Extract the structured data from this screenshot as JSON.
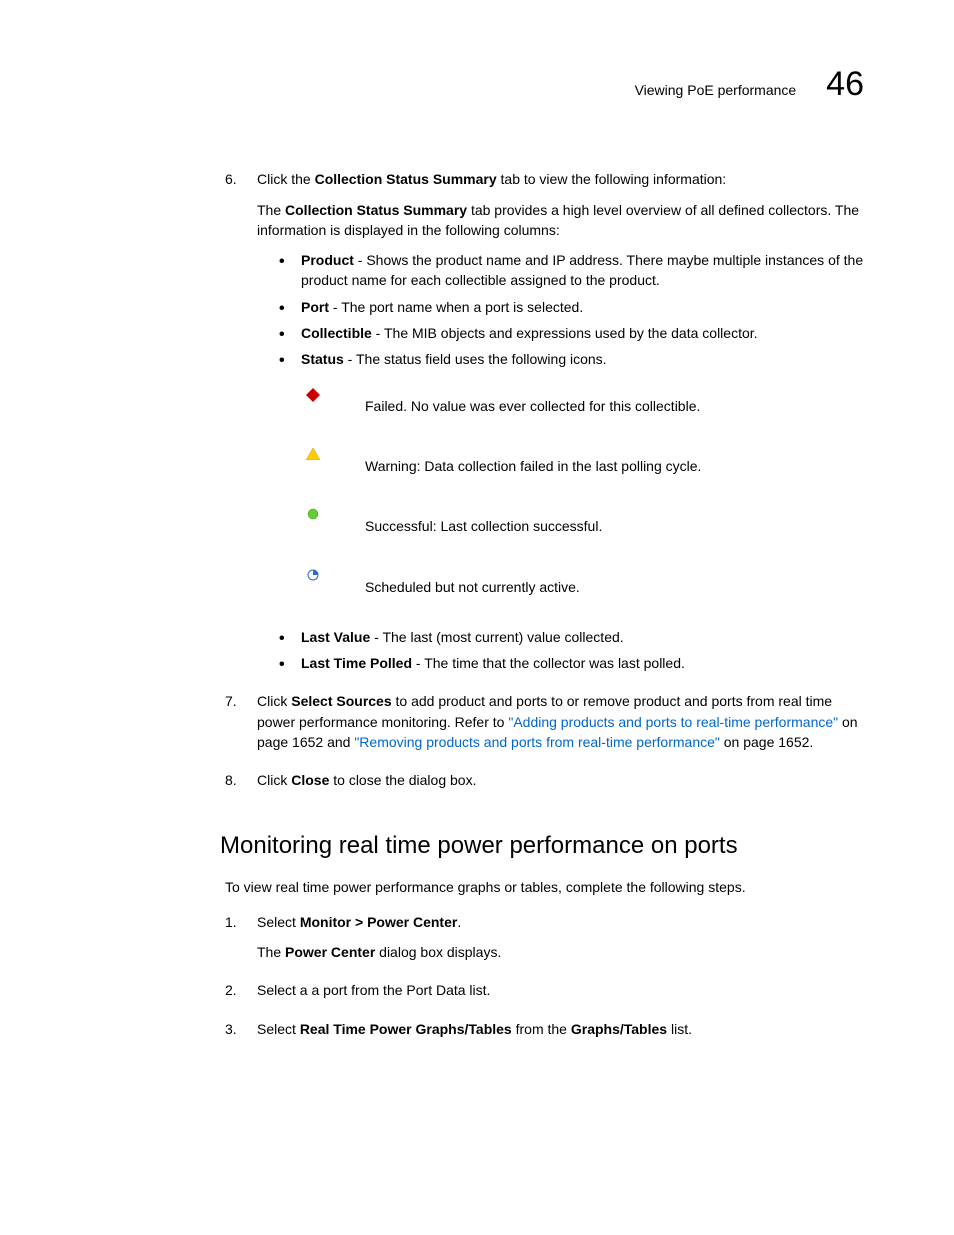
{
  "header": {
    "title": "Viewing PoE performance",
    "chapter": "46"
  },
  "step6": {
    "num": "6.",
    "p1_pre": "Click the ",
    "p1_bold": "Collection Status Summary",
    "p1_post": " tab to view the following information:",
    "p2_pre": "The ",
    "p2_bold": "Collection Status Summary",
    "p2_post": " tab provides a high level overview of all defined collectors. The information is displayed in the following columns:",
    "bullets": {
      "b1_bold": "Product",
      "b1_text": " - Shows the product name and IP address. There maybe multiple instances of the product name for each collectible assigned to the product.",
      "b2_bold": "Port",
      "b2_text": " - The port name when a port is selected.",
      "b3_bold": "Collectible",
      "b3_text": " - The MIB objects and expressions used by the data collector.",
      "b4_bold": "Status",
      "b4_text": " - The status field uses the following icons."
    },
    "status": {
      "s1": "Failed. No value was ever collected for this collectible.",
      "s2": "Warning: Data collection failed in the last polling cycle.",
      "s3": "Successful: Last collection successful.",
      "s4": "Scheduled but not currently active."
    },
    "bullets2": {
      "b5_bold": "Last Value",
      "b5_text": " - The last (most current) value collected.",
      "b6_bold": "Last Time Polled",
      "b6_text": " - The time that the collector was last polled."
    }
  },
  "step7": {
    "num": "7.",
    "p_pre": "Click ",
    "p_bold": "Select Sources",
    "p_mid": " to add product and ports to or remove product and ports from real time power performance monitoring. Refer to ",
    "link1": "\"Adding products and ports to real-time performance\"",
    "p_mid2": " on page 1652 and ",
    "link2": "\"Removing products and ports from real-time performance\"",
    "p_post": " on page 1652."
  },
  "step8": {
    "num": "8.",
    "p_pre": "Click ",
    "p_bold": "Close",
    "p_post": " to close the dialog box."
  },
  "section2": {
    "title": "Monitoring real time power performance on ports",
    "intro": "To view real time power performance graphs or tables, complete the following steps.",
    "step1": {
      "num": "1.",
      "p1_pre": "Select ",
      "p1_bold": "Monitor > Power Center",
      "p1_post": ".",
      "p2_pre": "The ",
      "p2_bold": "Power Center",
      "p2_post": " dialog box displays."
    },
    "step2": {
      "num": "2.",
      "text": "Select a a port from the Port Data list."
    },
    "step3": {
      "num": "3.",
      "p_pre": "Select ",
      "p_bold1": "Real Time Power Graphs/Tables",
      "p_mid": " from the ",
      "p_bold2": "Graphs/Tables",
      "p_post": " list."
    }
  }
}
